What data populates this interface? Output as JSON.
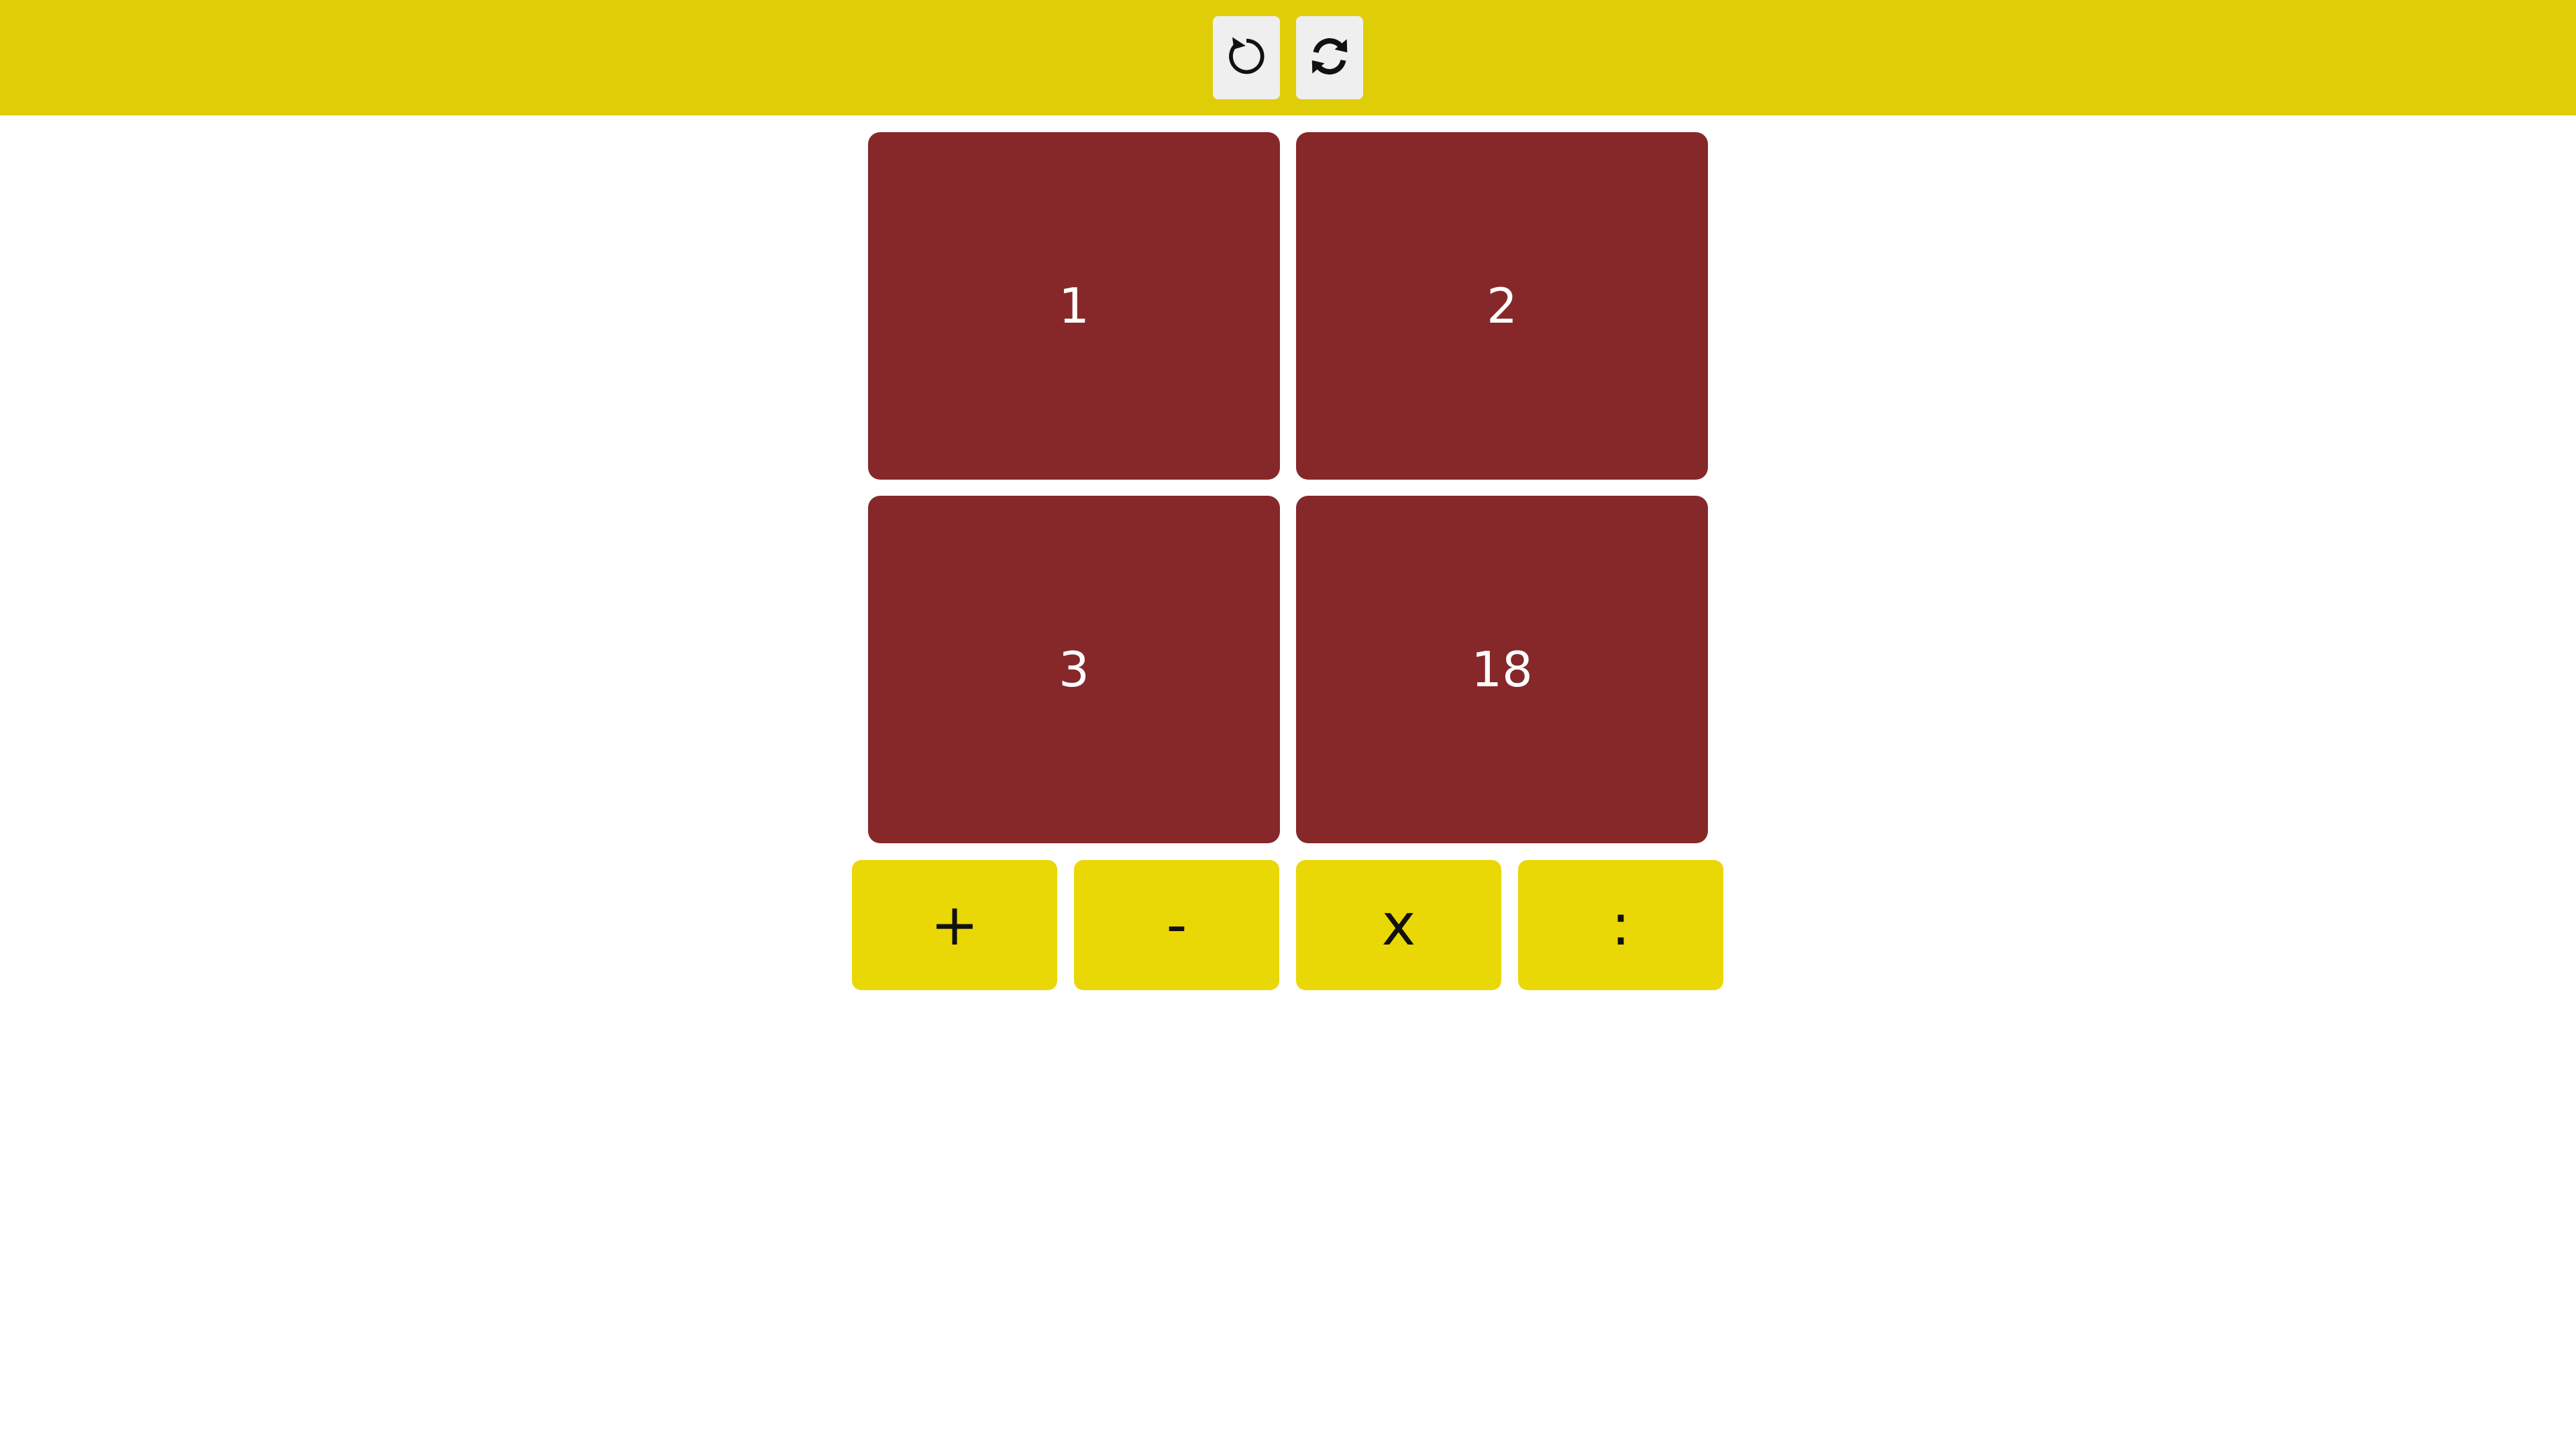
{
  "colors": {
    "topbar": "#dfcd08",
    "icon_button_bg": "#efefef",
    "card": "#86282a",
    "card_text": "#ffffff",
    "operator": "#ead706",
    "operator_text": "#111111"
  },
  "toolbar": {
    "undo_icon": "undo-icon",
    "reset_icon": "refresh-icon"
  },
  "cards": [
    "1",
    "2",
    "3",
    "18"
  ],
  "operators": [
    "+",
    "-",
    "x",
    ":"
  ]
}
